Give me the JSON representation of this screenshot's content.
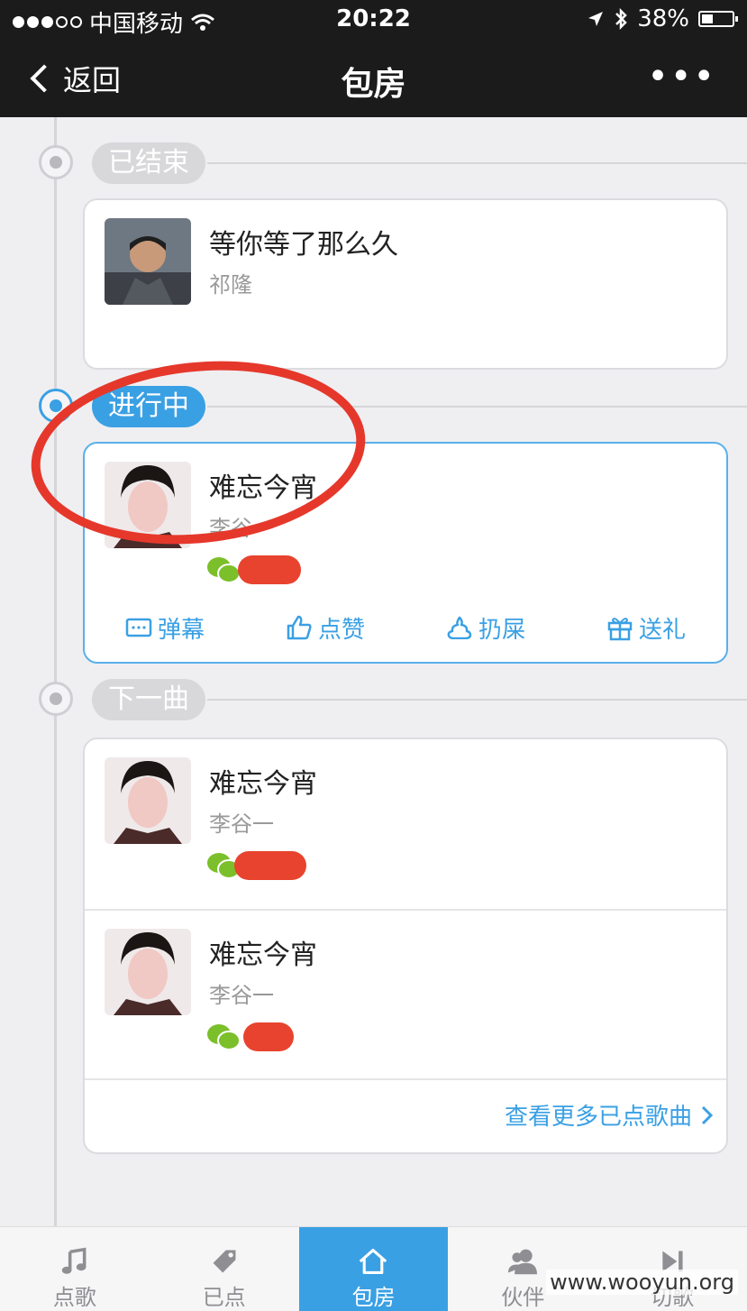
{
  "status_bar": {
    "carrier": "中国移动",
    "time": "20:22",
    "battery": "38%",
    "battery_level": 0.38
  },
  "nav": {
    "back_label": "返回",
    "title": "包房",
    "more_label": "•••"
  },
  "sections": {
    "finished": {
      "label": "已结束"
    },
    "playing": {
      "label": "进行中"
    },
    "next": {
      "label": "下一曲"
    }
  },
  "finished_song": {
    "title": "等你等了那么久",
    "artist": "祁隆"
  },
  "playing_song": {
    "title": "难忘今宵",
    "artist": "李谷一"
  },
  "actions": {
    "danmu": "弹幕",
    "like": "点赞",
    "throw": "扔屎",
    "gift": "送礼"
  },
  "queue": [
    {
      "title": "难忘今宵",
      "artist": "李谷一"
    },
    {
      "title": "难忘今宵",
      "artist": "李谷一"
    }
  ],
  "more_songs_link": "查看更多已点歌曲",
  "tabs": {
    "songs": "点歌",
    "ordered": "已点",
    "room": "包房",
    "partner": "伙伴",
    "skip": "切歌"
  },
  "watermark": "www.wooyun.org",
  "colors": {
    "accent": "#3aa0e4",
    "wechat": "#7bbf2a",
    "redaction": "#e8432e",
    "annotation": "#e5382b"
  }
}
